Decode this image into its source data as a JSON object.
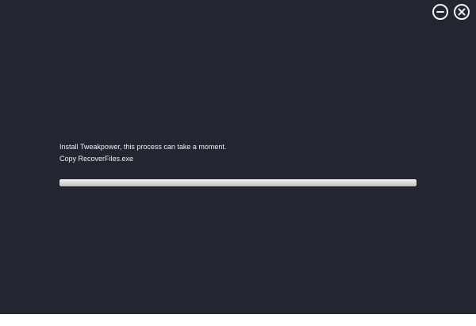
{
  "window": {
    "background": "#232531"
  },
  "controls": {
    "minimize_icon": "minus-circle-icon",
    "close_icon": "x-circle-icon"
  },
  "installer": {
    "message": "Install Tweakpower, this process can take a moment.",
    "current_file": "Copy RecoverFiles.exe",
    "progress_fraction": 1.0
  }
}
